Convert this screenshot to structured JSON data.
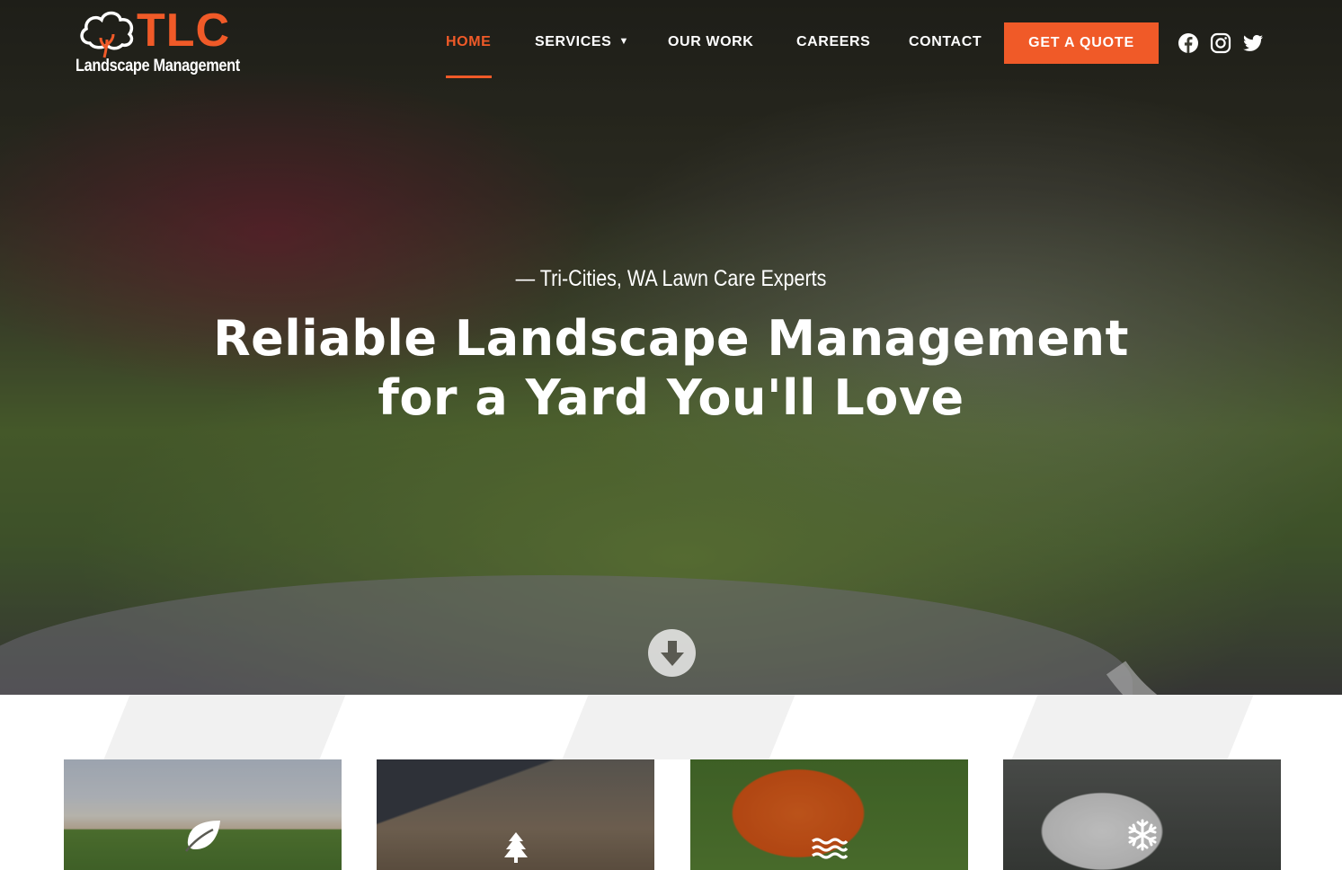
{
  "brand": {
    "logo_main": "TLC",
    "logo_sub": "Landscape Management",
    "accent": "#f05a28"
  },
  "nav": {
    "items": [
      {
        "label": "HOME",
        "active": true
      },
      {
        "label": "SERVICES",
        "has_dropdown": true
      },
      {
        "label": "OUR WORK"
      },
      {
        "label": "CAREERS"
      },
      {
        "label": "CONTACT"
      }
    ],
    "cta_label": "GET A QUOTE",
    "social_icons": [
      "facebook-icon",
      "instagram-icon",
      "twitter-icon"
    ]
  },
  "hero": {
    "tagline": "— Tri-Cities, WA Lawn Care Experts",
    "headline_line1": "Reliable Landscape Management",
    "headline_line2": "for a Yard You'll Love",
    "scroll_icon": "arrow-down-icon"
  },
  "service_cards": [
    {
      "icon": "leaf-icon"
    },
    {
      "icon": "tree-icon"
    },
    {
      "icon": "water-icon"
    },
    {
      "icon": "snowflake-icon"
    }
  ]
}
